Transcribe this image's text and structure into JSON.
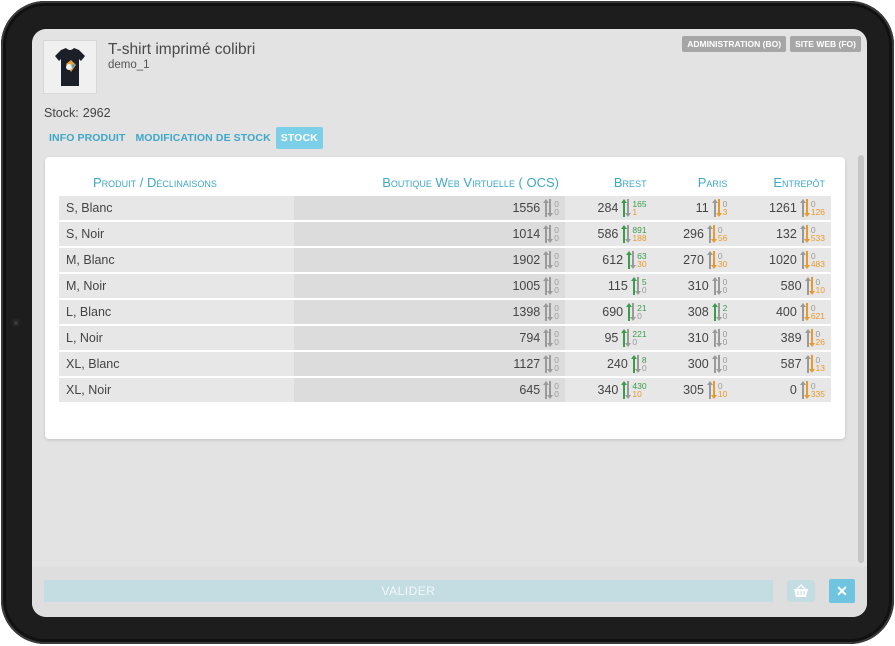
{
  "header": {
    "title": "T-shirt imprimé colibri",
    "reference": "demo_1",
    "admin_button": "ADMINISTRATION (BO)",
    "site_button": "SITE WEB (FO)"
  },
  "stock_summary": {
    "label": "Stock:",
    "value": "2962"
  },
  "tabs": [
    {
      "label": "INFO PRODUIT",
      "active": false
    },
    {
      "label": "MODIFICATION DE STOCK",
      "active": false
    },
    {
      "label": "STOCK",
      "active": true
    }
  ],
  "table": {
    "columns": [
      "Produit / Déclinaisons",
      "Boutique Web Virtuelle ( OCS)",
      "Brest",
      "Paris",
      "Entrepôt"
    ],
    "rows": [
      {
        "name": "S, Blanc",
        "cells": [
          {
            "value": "1556",
            "top": "0",
            "bottom": "0",
            "style": "gray"
          },
          {
            "value": "284",
            "top": "165",
            "bottom": "1",
            "style": "green"
          },
          {
            "value": "11",
            "top": "0",
            "bottom": "3",
            "style": "orange"
          },
          {
            "value": "1261",
            "top": "0",
            "bottom": "126",
            "style": "orange"
          }
        ]
      },
      {
        "name": "S, Noir",
        "cells": [
          {
            "value": "1014",
            "top": "0",
            "bottom": "0",
            "style": "gray"
          },
          {
            "value": "586",
            "top": "891",
            "bottom": "188",
            "style": "green"
          },
          {
            "value": "296",
            "top": "0",
            "bottom": "56",
            "style": "orange"
          },
          {
            "value": "132",
            "top": "0",
            "bottom": "533",
            "style": "orange"
          }
        ]
      },
      {
        "name": "M, Blanc",
        "cells": [
          {
            "value": "1902",
            "top": "0",
            "bottom": "0",
            "style": "gray"
          },
          {
            "value": "612",
            "top": "63",
            "bottom": "30",
            "style": "green"
          },
          {
            "value": "270",
            "top": "0",
            "bottom": "30",
            "style": "orange"
          },
          {
            "value": "1020",
            "top": "0",
            "bottom": "483",
            "style": "orange"
          }
        ]
      },
      {
        "name": "M, Noir",
        "cells": [
          {
            "value": "1005",
            "top": "0",
            "bottom": "0",
            "style": "gray"
          },
          {
            "value": "115",
            "top": "5",
            "bottom": "0",
            "style": "green"
          },
          {
            "value": "310",
            "top": "0",
            "bottom": "0",
            "style": "gray"
          },
          {
            "value": "580",
            "top": "0",
            "bottom": "10",
            "style": "orange"
          }
        ]
      },
      {
        "name": "L, Blanc",
        "cells": [
          {
            "value": "1398",
            "top": "0",
            "bottom": "0",
            "style": "gray"
          },
          {
            "value": "690",
            "top": "21",
            "bottom": "0",
            "style": "green"
          },
          {
            "value": "308",
            "top": "2",
            "bottom": "0",
            "style": "green"
          },
          {
            "value": "400",
            "top": "0",
            "bottom": "621",
            "style": "orange"
          }
        ]
      },
      {
        "name": "L, Noir",
        "cells": [
          {
            "value": "794",
            "top": "0",
            "bottom": "0",
            "style": "gray"
          },
          {
            "value": "95",
            "top": "221",
            "bottom": "0",
            "style": "green"
          },
          {
            "value": "310",
            "top": "0",
            "bottom": "0",
            "style": "gray"
          },
          {
            "value": "389",
            "top": "0",
            "bottom": "26",
            "style": "orange"
          }
        ]
      },
      {
        "name": "XL, Blanc",
        "cells": [
          {
            "value": "1127",
            "top": "0",
            "bottom": "0",
            "style": "gray"
          },
          {
            "value": "240",
            "top": "8",
            "bottom": "0",
            "style": "green"
          },
          {
            "value": "300",
            "top": "0",
            "bottom": "0",
            "style": "gray"
          },
          {
            "value": "587",
            "top": "0",
            "bottom": "13",
            "style": "orange"
          }
        ]
      },
      {
        "name": "XL, Noir",
        "cells": [
          {
            "value": "645",
            "top": "0",
            "bottom": "0",
            "style": "gray"
          },
          {
            "value": "340",
            "top": "430",
            "bottom": "10",
            "style": "green"
          },
          {
            "value": "305",
            "top": "0",
            "bottom": "10",
            "style": "orange"
          },
          {
            "value": "0",
            "top": "0",
            "bottom": "335",
            "style": "orange"
          }
        ]
      }
    ]
  },
  "footer": {
    "validate_label": "VALIDER"
  },
  "colors": {
    "accent": "#3fa7c7",
    "green": "#3a9d4a",
    "orange": "#e89a2c",
    "gray": "#9a9a9a"
  },
  "icons": {
    "basket": "basket-icon",
    "close": "close-icon"
  }
}
